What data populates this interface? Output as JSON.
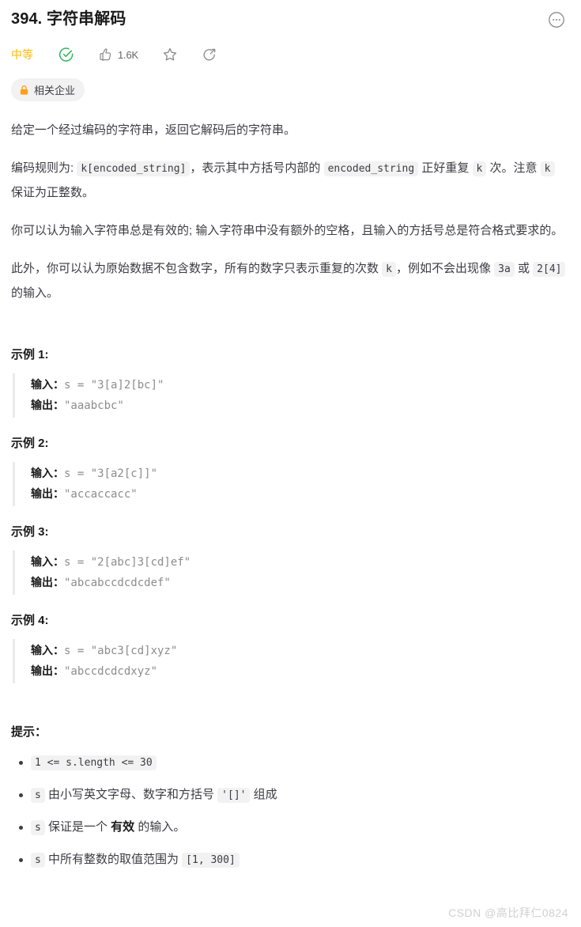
{
  "header": {
    "title": "394. 字符串解码",
    "more_icon": "ellipsis-circle-icon"
  },
  "meta": {
    "difficulty": "中等",
    "difficulty_color": "#ffb800",
    "solved_icon": "check-circle-icon",
    "solved_color": "#2db55d",
    "like_icon": "thumbs-up-icon",
    "like_count": "1.6K",
    "favorite_icon": "star-outline-icon",
    "share_icon": "share-icon",
    "company_tag": {
      "icon": "lock-icon",
      "icon_color": "#ff9f1a",
      "label": "相关企业"
    }
  },
  "description": {
    "p1": "给定一个经过编码的字符串，返回它解码后的字符串。",
    "p2_a": "编码规则为: ",
    "p2_code1": "k[encoded_string]",
    "p2_b": "，表示其中方括号内部的 ",
    "p2_code2": "encoded_string",
    "p2_c": " 正好重复 ",
    "p2_code3": "k",
    "p2_d": " 次。注意 ",
    "p2_code4": "k",
    "p2_e": " 保证为正整数。",
    "p3": "你可以认为输入字符串总是有效的; 输入字符串中没有额外的空格，且输入的方括号总是符合格式要求的。",
    "p4_a": "此外，你可以认为原始数据不包含数字，所有的数字只表示重复的次数 ",
    "p4_code1": "k",
    "p4_b": "，例如不会出现像 ",
    "p4_code2": "3a",
    "p4_c": " 或 ",
    "p4_code3": "2[4]",
    "p4_d": " 的输入。"
  },
  "labels": {
    "input": "输入：",
    "output": "输出：",
    "hints_title": "提示："
  },
  "examples": [
    {
      "title": "示例 1:",
      "input": "s = \"3[a]2[bc]\"",
      "output": "\"aaabcbc\""
    },
    {
      "title": "示例 2:",
      "input": "s = \"3[a2[c]]\"",
      "output": "\"accaccacc\""
    },
    {
      "title": "示例 3:",
      "input": "s = \"2[abc]3[cd]ef\"",
      "output": "\"abcabccdcdcdef\""
    },
    {
      "title": "示例 4:",
      "input": "s = \"abc3[cd]xyz\"",
      "output": "\"abccdcdcdxyz\""
    }
  ],
  "hints": {
    "h1_code": "1 <= s.length <= 30",
    "h2_code1": "s",
    "h2_text_a": " 由小写英文字母、数字和方括号 ",
    "h2_code2": "'[]'",
    "h2_text_b": " 组成",
    "h3_code1": "s",
    "h3_text_a": " 保证是一个 ",
    "h3_bold": "有效",
    "h3_text_b": " 的输入。",
    "h4_code1": "s",
    "h4_text_a": " 中所有整数的取值范围为 ",
    "h4_code2": "[1, 300]"
  },
  "watermark": "CSDN @高比拜仁0824"
}
